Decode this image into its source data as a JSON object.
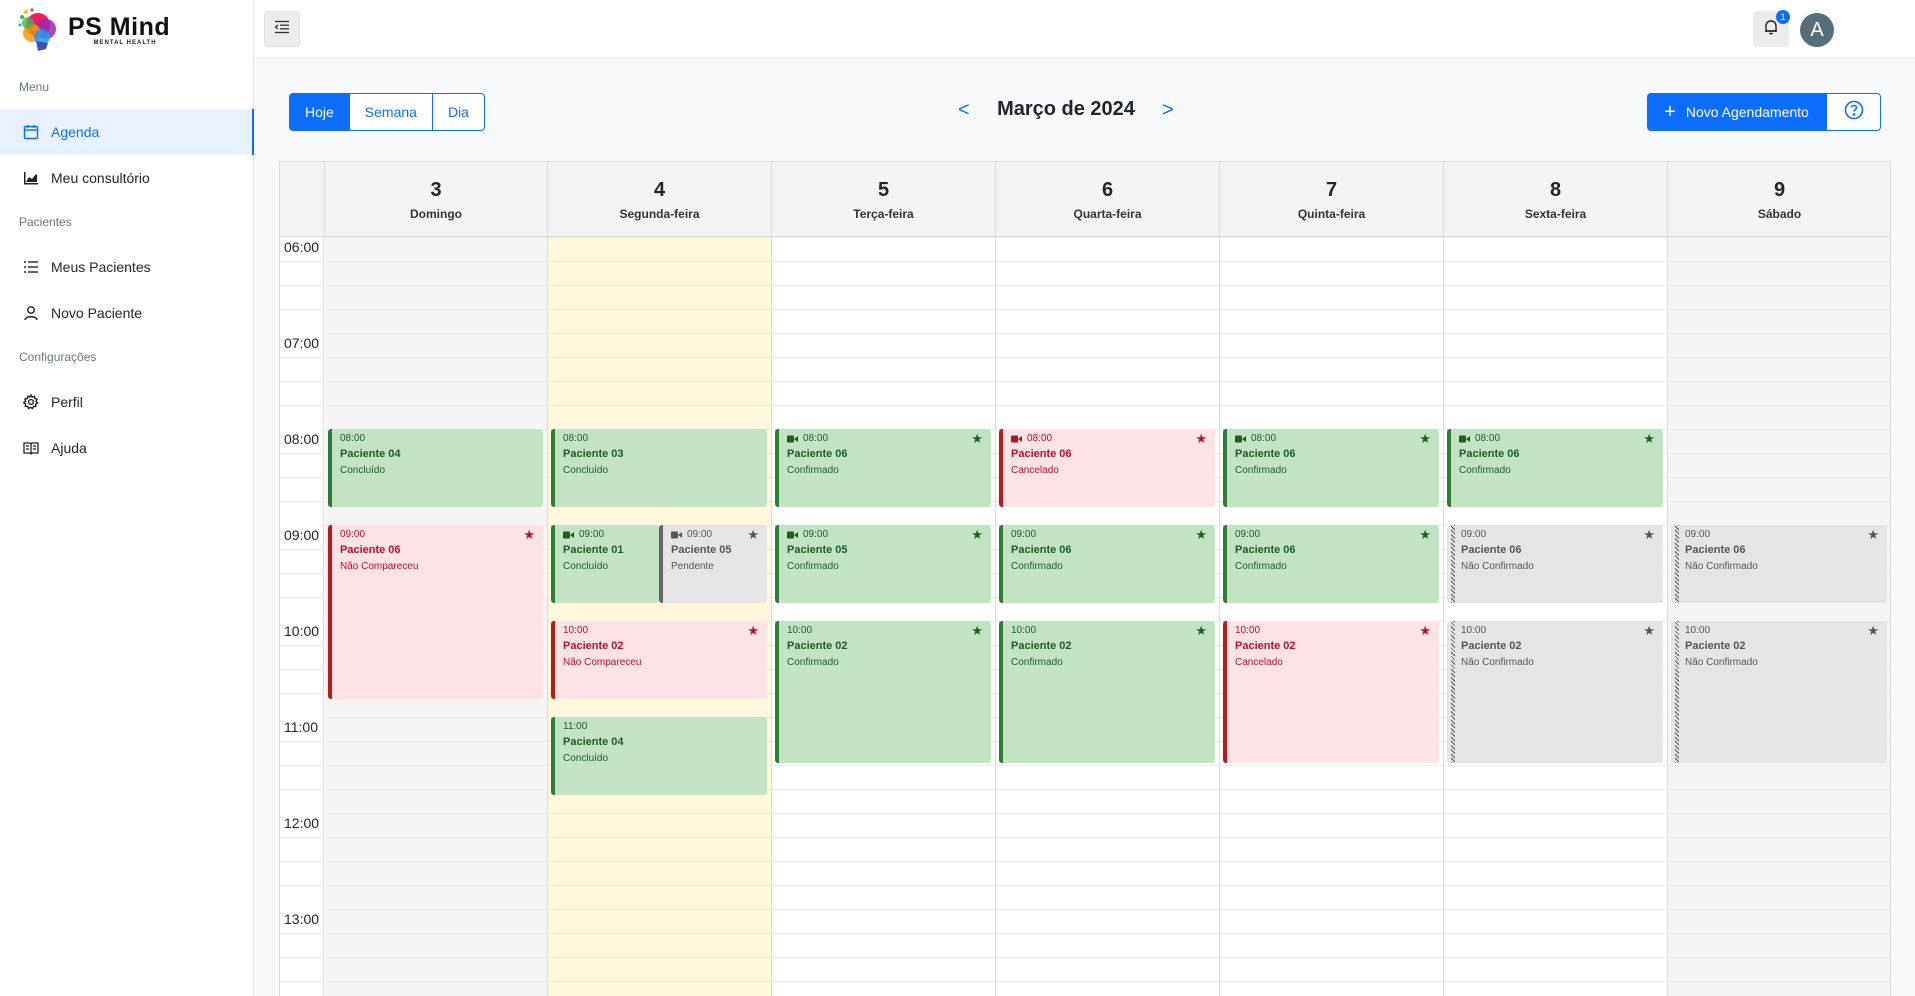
{
  "logo": {
    "title": "PS Mind",
    "subtitle": "MENTAL HEALTH"
  },
  "sidebar": {
    "sections": [
      "Menu",
      "Pacientes",
      "Configurações"
    ],
    "items": [
      {
        "label": "Agenda",
        "icon": "calendar-icon",
        "active": true
      },
      {
        "label": "Meu consultório",
        "icon": "chart-icon"
      },
      {
        "label": "Meus Pacientes",
        "icon": "list-icon"
      },
      {
        "label": "Novo Paciente",
        "icon": "user-icon"
      },
      {
        "label": "Perfil",
        "icon": "gear-icon"
      },
      {
        "label": "Ajuda",
        "icon": "book-icon"
      }
    ]
  },
  "topbar": {
    "notification_count": "1",
    "avatar_letter": "A"
  },
  "toolbar": {
    "views": [
      "Hoje",
      "Semana",
      "Dia"
    ],
    "prev": "<",
    "next": ">",
    "month_title": "Março de 2024",
    "new_button": "Novo Agendamento",
    "new_button_icon": "plus-icon",
    "help_icon": "help-icon"
  },
  "calendar": {
    "days": [
      {
        "num": "3",
        "name": "Domingo"
      },
      {
        "num": "4",
        "name": "Segunda-feira"
      },
      {
        "num": "5",
        "name": "Terça-feira"
      },
      {
        "num": "6",
        "name": "Quarta-feira"
      },
      {
        "num": "7",
        "name": "Quinta-feira"
      },
      {
        "num": "8",
        "name": "Sexta-feira"
      },
      {
        "num": "9",
        "name": "Sábado"
      }
    ],
    "hours": [
      "06:00",
      "07:00",
      "08:00",
      "09:00",
      "10:00",
      "11:00",
      "12:00",
      "13:00"
    ],
    "events": [
      {
        "day": 0,
        "start": "08:00",
        "end": "08:50",
        "patient": "Paciente 04",
        "status": "Concluído",
        "style": "green",
        "video": false,
        "star": false
      },
      {
        "day": 0,
        "start": "09:00",
        "end": "10:50",
        "patient": "Paciente 06",
        "status": "Não Compareceu",
        "style": "red",
        "video": false,
        "star": true
      },
      {
        "day": 1,
        "start": "08:00",
        "end": "08:50",
        "patient": "Paciente 03",
        "status": "Concluído",
        "style": "green",
        "video": false,
        "star": false
      },
      {
        "day": 1,
        "start": "09:00",
        "end": "09:50",
        "patient": "Paciente 01",
        "status": "Concluído",
        "style": "green",
        "video": true,
        "star": false,
        "half": "left"
      },
      {
        "day": 1,
        "start": "09:00",
        "end": "09:50",
        "patient": "Paciente 05",
        "status": "Pendente",
        "style": "gray",
        "video": true,
        "star": true,
        "half": "right"
      },
      {
        "day": 1,
        "start": "10:00",
        "end": "10:50",
        "patient": "Paciente 02",
        "status": "Não Compareceu",
        "style": "red",
        "video": false,
        "star": true
      },
      {
        "day": 1,
        "start": "11:00",
        "end": "11:50",
        "patient": "Paciente 04",
        "status": "Concluído",
        "style": "green",
        "video": false,
        "star": false
      },
      {
        "day": 2,
        "start": "08:00",
        "end": "08:50",
        "patient": "Paciente 06",
        "status": "Confirmado",
        "style": "green",
        "video": true,
        "star": true
      },
      {
        "day": 2,
        "start": "09:00",
        "end": "09:50",
        "patient": "Paciente 05",
        "status": "Confirmado",
        "style": "green",
        "video": true,
        "star": true
      },
      {
        "day": 2,
        "start": "10:00",
        "end": "11:30",
        "patient": "Paciente 02",
        "status": "Confirmado",
        "style": "green",
        "video": false,
        "star": true
      },
      {
        "day": 3,
        "start": "08:00",
        "end": "08:50",
        "patient": "Paciente 06",
        "status": "Cancelado",
        "style": "red",
        "video": true,
        "star": true
      },
      {
        "day": 3,
        "start": "09:00",
        "end": "09:50",
        "patient": "Paciente 06",
        "status": "Confirmado",
        "style": "green",
        "video": false,
        "star": true
      },
      {
        "day": 3,
        "start": "10:00",
        "end": "11:30",
        "patient": "Paciente 02",
        "status": "Confirmado",
        "style": "green",
        "video": false,
        "star": true
      },
      {
        "day": 4,
        "start": "08:00",
        "end": "08:50",
        "patient": "Paciente 06",
        "status": "Confirmado",
        "style": "green",
        "video": true,
        "star": true
      },
      {
        "day": 4,
        "start": "09:00",
        "end": "09:50",
        "patient": "Paciente 06",
        "status": "Confirmado",
        "style": "green",
        "video": false,
        "star": true
      },
      {
        "day": 4,
        "start": "10:00",
        "end": "11:30",
        "patient": "Paciente 02",
        "status": "Cancelado",
        "style": "red",
        "video": false,
        "star": true
      },
      {
        "day": 5,
        "start": "08:00",
        "end": "08:50",
        "patient": "Paciente 06",
        "status": "Confirmado",
        "style": "green",
        "video": true,
        "star": true
      },
      {
        "day": 5,
        "start": "09:00",
        "end": "09:50",
        "patient": "Paciente 06",
        "status": "Não Confirmado",
        "style": "hatch",
        "video": false,
        "star": true
      },
      {
        "day": 5,
        "start": "10:00",
        "end": "11:30",
        "patient": "Paciente 02",
        "status": "Não Confirmado",
        "style": "hatch",
        "video": false,
        "star": true
      },
      {
        "day": 6,
        "start": "09:00",
        "end": "09:50",
        "patient": "Paciente 06",
        "status": "Não Confirmado",
        "style": "hatch",
        "video": false,
        "star": true
      },
      {
        "day": 6,
        "start": "10:00",
        "end": "11:30",
        "patient": "Paciente 02",
        "status": "Não Confirmado",
        "style": "hatch",
        "video": false,
        "star": true
      }
    ],
    "colors": {
      "today_bg": "#fff8dc",
      "weekend_bg": "#f5f5f5",
      "green_bg": "#c2e4c4",
      "red_bg": "#fde2e6",
      "gray_bg": "#e5e5e5",
      "accent": "#0d6efd"
    }
  }
}
